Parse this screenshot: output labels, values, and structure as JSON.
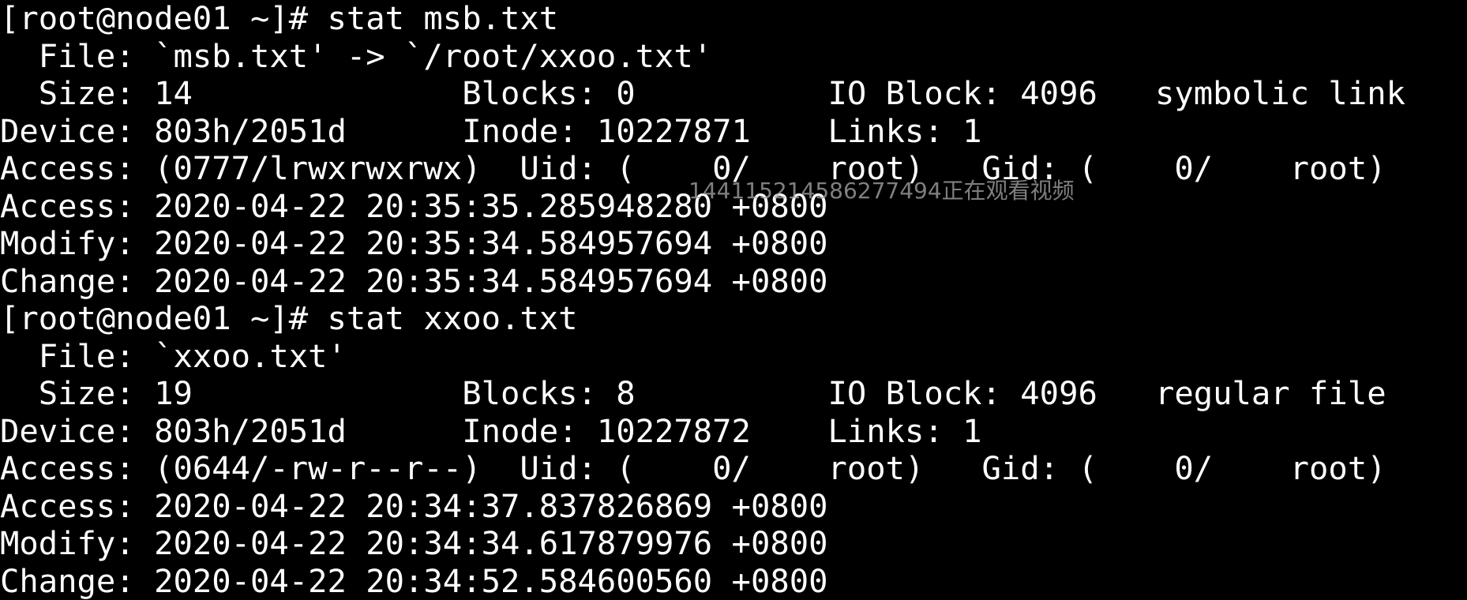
{
  "terminal": {
    "lines": [
      "[root@node01 ~]# stat msb.txt",
      "  File: `msb.txt' -> `/root/xxoo.txt'",
      "  Size: 14              Blocks: 0          IO Block: 4096   symbolic link",
      "Device: 803h/2051d      Inode: 10227871    Links: 1",
      "Access: (0777/lrwxrwxrwx)  Uid: (    0/    root)   Gid: (    0/    root)",
      "Access: 2020-04-22 20:35:35.285948280 +0800",
      "Modify: 2020-04-22 20:35:34.584957694 +0800",
      "Change: 2020-04-22 20:35:34.584957694 +0800",
      "[root@node01 ~]# stat xxoo.txt",
      "  File: `xxoo.txt'",
      "  Size: 19              Blocks: 8          IO Block: 4096   regular file",
      "Device: 803h/2051d      Inode: 10227872    Links: 1",
      "Access: (0644/-rw-r--r--)  Uid: (    0/    root)   Gid: (    0/    root)",
      "Access: 2020-04-22 20:34:37.837826869 +0800",
      "Modify: 2020-04-22 20:34:34.617879976 +0800",
      "Change: 2020-04-22 20:34:52.584600560 +0800"
    ]
  },
  "watermark": {
    "text": "1441152145862774​94正在观看视频"
  },
  "colors": {
    "background": "#000000",
    "foreground": "#ffffff",
    "watermark": "#aaaaaa"
  }
}
